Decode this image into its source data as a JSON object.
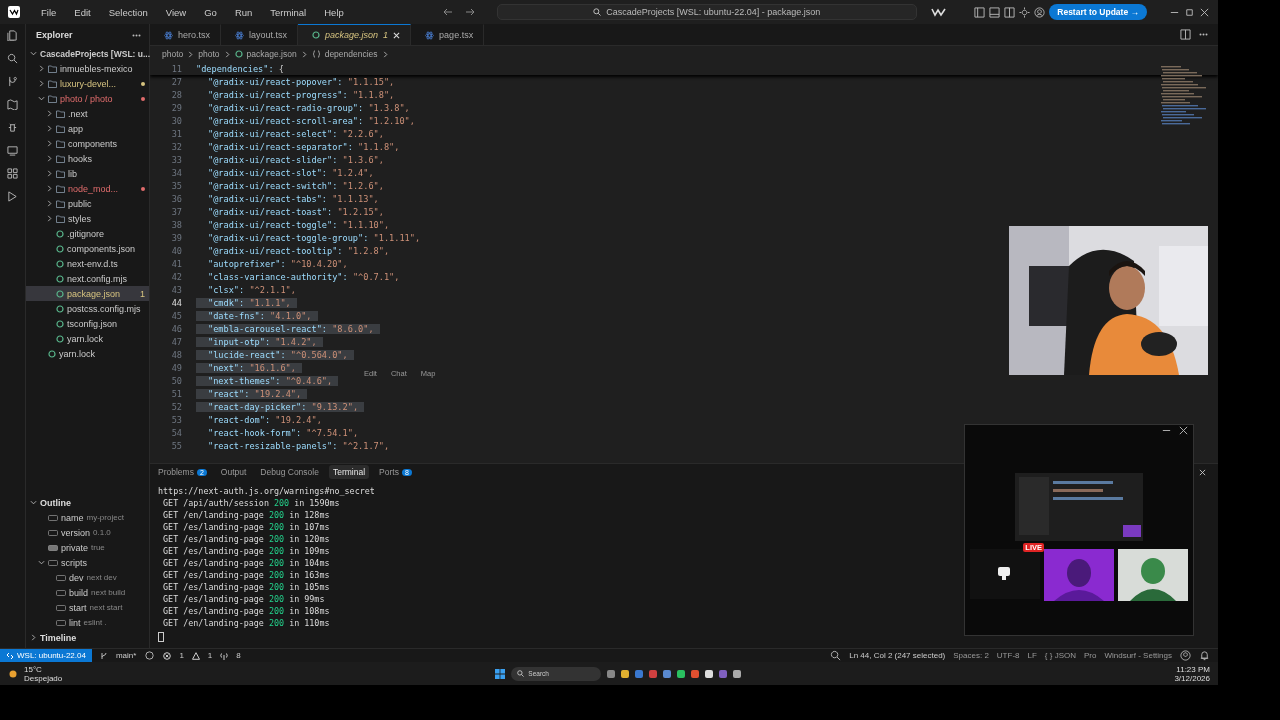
{
  "titlebar": {
    "menus": [
      "File",
      "Edit",
      "Selection",
      "View",
      "Go",
      "Run",
      "Terminal",
      "Help"
    ],
    "command_center": "CascadeProjects [WSL: ubuntu-22.04] - package.json",
    "update_button": "Restart to Update →"
  },
  "sidebar": {
    "title": "Explorer",
    "root": "CascadeProjects [WSL: u...",
    "tree": [
      {
        "label": "inmuebles-mexico",
        "kind": "folder",
        "expanded": false,
        "warning": false,
        "error": false,
        "modified": false,
        "selected": false
      },
      {
        "label": "luxury-devel...",
        "kind": "folder",
        "expanded": false,
        "warning": true,
        "error": false,
        "modified": true,
        "selected": false
      },
      {
        "label": "photo / photo",
        "kind": "folder",
        "expanded": true,
        "warning": false,
        "error": true,
        "modified": true,
        "selected": false,
        "children": [
          {
            "label": ".next",
            "kind": "folder",
            "expanded": false,
            "warning": false,
            "error": false,
            "modified": false,
            "selected": false
          },
          {
            "label": "app",
            "kind": "folder",
            "expanded": false,
            "warning": false,
            "error": false,
            "modified": false,
            "selected": false
          },
          {
            "label": "components",
            "kind": "folder",
            "expanded": false,
            "warning": false,
            "error": false,
            "modified": false,
            "selected": false
          },
          {
            "label": "hooks",
            "kind": "folder",
            "expanded": false,
            "warning": false,
            "error": false,
            "modified": false,
            "selected": false
          },
          {
            "label": "lib",
            "kind": "folder",
            "expanded": false,
            "warning": false,
            "error": false,
            "modified": false,
            "selected": false
          },
          {
            "label": "node_mod...",
            "kind": "folder",
            "expanded": false,
            "warning": false,
            "error": true,
            "modified": true,
            "selected": false
          },
          {
            "label": "public",
            "kind": "folder",
            "expanded": false,
            "warning": false,
            "error": false,
            "modified": false,
            "selected": false
          },
          {
            "label": "styles",
            "kind": "folder",
            "expanded": false,
            "warning": false,
            "error": false,
            "modified": false,
            "selected": false
          },
          {
            "label": ".gitignore",
            "kind": "file",
            "warning": false,
            "error": false,
            "modified": false,
            "selected": false
          },
          {
            "label": "components.json",
            "kind": "file",
            "warning": false,
            "error": false,
            "modified": false,
            "selected": false
          },
          {
            "label": "next-env.d.ts",
            "kind": "file",
            "warning": false,
            "error": false,
            "modified": false,
            "selected": false
          },
          {
            "label": "next.config.mjs",
            "kind": "file",
            "warning": false,
            "error": false,
            "modified": false,
            "selected": false
          },
          {
            "label": "package.json",
            "kind": "file",
            "warning": true,
            "error": false,
            "modified": false,
            "selected": true,
            "badge": "1"
          },
          {
            "label": "postcss.config.mjs",
            "kind": "file",
            "warning": false,
            "error": false,
            "modified": false,
            "selected": false
          },
          {
            "label": "tsconfig.json",
            "kind": "file",
            "warning": false,
            "error": false,
            "modified": false,
            "selected": false
          },
          {
            "label": "yarn.lock",
            "kind": "file",
            "warning": false,
            "error": false,
            "modified": false,
            "selected": false
          }
        ]
      },
      {
        "label": "yarn.lock",
        "kind": "file",
        "warning": false,
        "error": false,
        "modified": false,
        "selected": false
      }
    ],
    "outline": {
      "title": "Outline",
      "expanded": true,
      "items": [
        {
          "name": "name",
          "detail": "my-project",
          "kind": "string"
        },
        {
          "name": "version",
          "detail": "0.1.0",
          "kind": "string"
        },
        {
          "name": "private",
          "detail": "true",
          "kind": "boolean"
        },
        {
          "name": "scripts",
          "kind": "object",
          "expanded": true,
          "children": [
            {
              "name": "dev",
              "detail": "next dev",
              "kind": "string"
            },
            {
              "name": "build",
              "detail": "next build",
              "kind": "string"
            },
            {
              "name": "start",
              "detail": "next start",
              "kind": "string"
            },
            {
              "name": "lint",
              "detail": "eslint .",
              "kind": "string"
            }
          ]
        }
      ]
    },
    "timeline": {
      "title": "Timeline",
      "expanded": false
    }
  },
  "tabs": [
    {
      "label": "hero.tsx",
      "kind": "react",
      "selected": false
    },
    {
      "label": "layout.tsx",
      "kind": "react",
      "selected": false
    },
    {
      "label": "package.json",
      "kind": "json",
      "selected": true,
      "badge": "1"
    },
    {
      "label": "page.tsx",
      "kind": "react",
      "selected": false
    }
  ],
  "breadcrumbs": [
    "photo",
    "photo",
    "package.json",
    "dependencies"
  ],
  "editor": {
    "sticky": {
      "number": "11",
      "key": "\"dependencies\":",
      "value": "{"
    },
    "lines": [
      {
        "number": "27",
        "key": "\"@radix-ui/react-popover\":",
        "value": "\"1.1.15\",",
        "selected": false
      },
      {
        "number": "28",
        "key": "\"@radix-ui/react-progress\":",
        "value": "\"1.1.8\",",
        "selected": false
      },
      {
        "number": "29",
        "key": "\"@radix-ui/react-radio-group\":",
        "value": "\"1.3.8\",",
        "selected": false
      },
      {
        "number": "30",
        "key": "\"@radix-ui/react-scroll-area\":",
        "value": "\"1.2.10\",",
        "selected": false
      },
      {
        "number": "31",
        "key": "\"@radix-ui/react-select\":",
        "value": "\"2.2.6\",",
        "selected": false
      },
      {
        "number": "32",
        "key": "\"@radix-ui/react-separator\":",
        "value": "\"1.1.8\",",
        "selected": false
      },
      {
        "number": "33",
        "key": "\"@radix-ui/react-slider\":",
        "value": "\"1.3.6\",",
        "selected": false
      },
      {
        "number": "34",
        "key": "\"@radix-ui/react-slot\":",
        "value": "\"1.2.4\",",
        "selected": false
      },
      {
        "number": "35",
        "key": "\"@radix-ui/react-switch\":",
        "value": "\"1.2.6\",",
        "selected": false
      },
      {
        "number": "36",
        "key": "\"@radix-ui/react-tabs\":",
        "value": "\"1.1.13\",",
        "selected": false
      },
      {
        "number": "37",
        "key": "\"@radix-ui/react-toast\":",
        "value": "\"1.2.15\",",
        "selected": false
      },
      {
        "number": "38",
        "key": "\"@radix-ui/react-toggle\":",
        "value": "\"1.1.10\",",
        "selected": false
      },
      {
        "number": "39",
        "key": "\"@radix-ui/react-toggle-group\":",
        "value": "\"1.1.11\",",
        "selected": false
      },
      {
        "number": "40",
        "key": "\"@radix-ui/react-tooltip\":",
        "value": "\"1.2.8\",",
        "selected": false
      },
      {
        "number": "41",
        "key": "\"autoprefixer\":",
        "value": "\"^10.4.20\",",
        "selected": false
      },
      {
        "number": "42",
        "key": "\"class-variance-authority\":",
        "value": "\"^0.7.1\",",
        "selected": false
      },
      {
        "number": "43",
        "key": "\"clsx\":",
        "value": "\"^2.1.1\",",
        "selected": false
      },
      {
        "number": "44",
        "key": "\"cmdk\":",
        "value": "\"1.1.1\",",
        "selected": true
      },
      {
        "number": "45",
        "key": "\"date-fns\":",
        "value": "\"4.1.0\",",
        "selected": true
      },
      {
        "number": "46",
        "key": "\"embla-carousel-react\":",
        "value": "\"8.6.0\",",
        "selected": true
      },
      {
        "number": "47",
        "key": "\"input-otp\":",
        "value": "\"1.4.2\",",
        "selected": true
      },
      {
        "number": "48",
        "key": "\"lucide-react\":",
        "value": "\"^0.564.0\",",
        "selected": true
      },
      {
        "number": "49",
        "key": "\"next\":",
        "value": "\"16.1.6\",",
        "selected": true
      },
      {
        "number": "50",
        "key": "\"next-themes\":",
        "value": "\"^0.4.6\",",
        "selected": true
      },
      {
        "number": "51",
        "key": "\"react\":",
        "value": "\"19.2.4\",",
        "selected": true
      },
      {
        "number": "52",
        "key": "\"react-day-picker\":",
        "value": "\"9.13.2\",",
        "selected": true
      },
      {
        "number": "53",
        "key": "\"react-dom\":",
        "value": "\"19.2.4\",",
        "selected": false
      },
      {
        "number": "54",
        "key": "\"react-hook-form\":",
        "value": "\"^7.54.1\",",
        "selected": false
      },
      {
        "number": "55",
        "key": "\"react-resizable-panels\":",
        "value": "\"^2.1.7\",",
        "selected": false
      }
    ],
    "hints": [
      "Edit",
      "Chat",
      "Map"
    ]
  },
  "panel": {
    "tabs": [
      {
        "label": "Problems",
        "badge": "2",
        "selected": false
      },
      {
        "label": "Output",
        "selected": false
      },
      {
        "label": "Debug Console",
        "selected": false
      },
      {
        "label": "Terminal",
        "selected": true
      },
      {
        "label": "Ports",
        "badge": "8",
        "selected": false
      }
    ],
    "terminal": {
      "url": "https://next-auth.js.org/warnings#no_secret",
      "requests": [
        {
          "request": "GET /api/auth/session",
          "status": "200",
          "time": "in 1590ms"
        },
        {
          "request": "GET /en/landing-page",
          "status": "200",
          "time": "in 128ms"
        },
        {
          "request": "GET /es/landing-page",
          "status": "200",
          "time": "in 107ms"
        },
        {
          "request": "GET /es/landing-page",
          "status": "200",
          "time": "in 120ms"
        },
        {
          "request": "GET /es/landing-page",
          "status": "200",
          "time": "in 109ms"
        },
        {
          "request": "GET /es/landing-page",
          "status": "200",
          "time": "in 104ms"
        },
        {
          "request": "GET /es/landing-page",
          "status": "200",
          "time": "in 163ms"
        },
        {
          "request": "GET /es/landing-page",
          "status": "200",
          "time": "in 105ms"
        },
        {
          "request": "GET /es/landing-page",
          "status": "200",
          "time": "in 99ms"
        },
        {
          "request": "GET /es/landing-page",
          "status": "200",
          "time": "in 108ms"
        },
        {
          "request": "GET /en/landing-page",
          "status": "200",
          "time": "in 110ms"
        }
      ]
    }
  },
  "floating_window": {
    "live_badge": "LIVE"
  },
  "status_bar": {
    "remote": "WSL: ubuntu-22.04",
    "branch": "main*",
    "errors": "1",
    "warnings": "1",
    "ports": "8",
    "position": "Ln 44, Col 2 (247 selected)",
    "items": [
      "Spaces: 2",
      "UTF-8",
      "LF",
      "{ } JSON",
      "Pro",
      "Windsurf - Settings"
    ]
  },
  "taskbar": {
    "temperature": "15°C",
    "weather": "Despejado",
    "search": "Search",
    "time": "11:23 PM",
    "date": "3/12/2026"
  }
}
